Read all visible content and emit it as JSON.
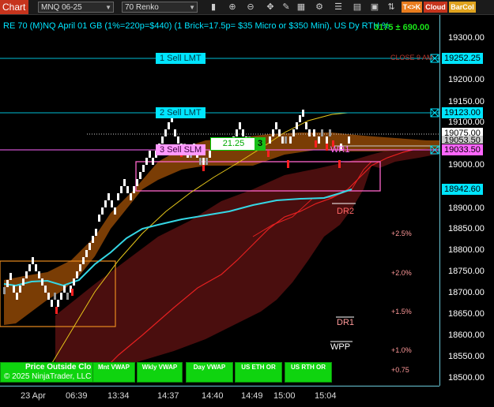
{
  "toolbar": {
    "chart_tab": "Chart",
    "instrument": "MNQ 06-25",
    "bar_type": "70 Renko",
    "buttons": [
      "T<>K",
      "Cloud",
      "BarCol"
    ]
  },
  "chart": {
    "title": "RE 70 (M)NQ April 01 GB (1%=220p=$440) (1 Brick=17.5p= $35 Micro or $350 Mini), US Dy RTH %",
    "pnl": "690.00",
    "pnl_prefix": "3175 ±",
    "order_1": "1 Sell LMT",
    "order_2": "2 Sell LMT",
    "order_3": "3 Sell SLM",
    "order_qty": "3",
    "order_value": "21.25",
    "close_label": "CLOSE 9 AM",
    "wr1": "WR1",
    "dr2": "DR2",
    "dr1": "DR1",
    "wpp": "WPP",
    "pct_labels": [
      "+2.5%",
      "+2.0%",
      "+1.5%",
      "+1.0%",
      "+0.75"
    ],
    "price_outside": "Price Outside Clo",
    "copyright": "© 2025 NinjaTrader, LLC",
    "vwap_buttons": [
      "Mnt VWAP",
      "Wkly VWAP",
      "Day VWAP",
      "US ETH OR",
      "US RTH OR"
    ]
  },
  "price_axis": {
    "labels": [
      "19300.00",
      "19250.00",
      "19200.00",
      "19150.00",
      "19100.00",
      "19050.00",
      "19000.00",
      "18950.00",
      "18900.00",
      "18850.00",
      "18800.00",
      "18750.00",
      "18700.00",
      "18650.00",
      "18600.00",
      "18550.00",
      "18500.00"
    ],
    "tags": [
      {
        "text": "19252.25",
        "color": "#00e5ff"
      },
      {
        "text": "19123.00",
        "color": "#00e5ff"
      },
      {
        "text": "19075.00",
        "color": "#ffffff"
      },
      {
        "text": "19053.50",
        "color": "#cccccc"
      },
      {
        "text": "19033.50",
        "color": "#ff66ff"
      },
      {
        "text": "18942.60",
        "color": "#00e5ff"
      }
    ]
  },
  "time_axis": {
    "labels": [
      "23 Apr",
      "06:39",
      "13:34",
      "14:37",
      "14:40",
      "14:49",
      "15:00",
      "15:04"
    ]
  }
}
